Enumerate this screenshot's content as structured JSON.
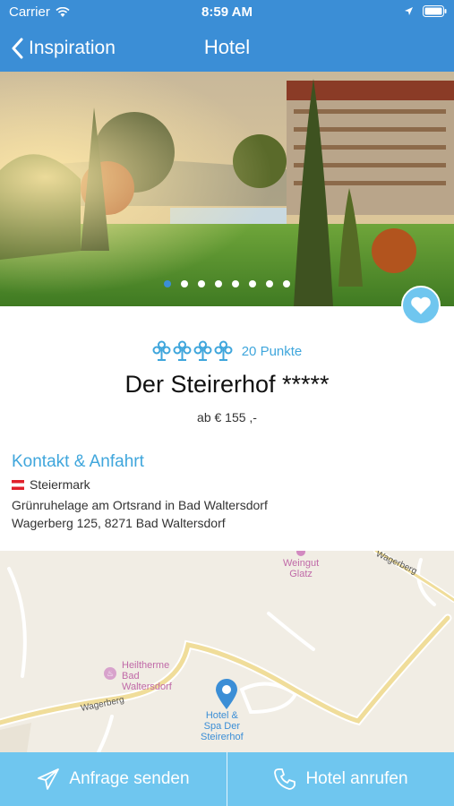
{
  "status_bar": {
    "carrier": "Carrier",
    "time": "8:59 AM"
  },
  "nav": {
    "back_label": "Inspiration",
    "title": "Hotel"
  },
  "gallery": {
    "photo_count": 8,
    "active_index": 0
  },
  "hotel": {
    "points": "20 Punkte",
    "name": "Der Steirerhof *****",
    "price": "ab € 155 ,-"
  },
  "contact": {
    "heading": "Kontakt & Anfahrt",
    "region": "Steiermark",
    "location_note": "Grünruhelage am Ortsrand in Bad Waltersdorf",
    "address": "Wagerberg 125, 8271 Bad Waltersdorf"
  },
  "map": {
    "poi_weingut_line1": "Weingut",
    "poi_weingut_line2": "Glatz",
    "poi_therme_line1": "Heiltherme",
    "poi_therme_line2": "Bad",
    "poi_therme_line3": "Waltersdorf",
    "hotel_line1": "Hotel &",
    "hotel_line2": "Spa Der",
    "hotel_line3": "Steirerhof",
    "road_wagerberg_1": "Wagerberg",
    "road_wagerberg_2": "Wagerberg"
  },
  "actions": {
    "inquiry": "Anfrage senden",
    "call": "Hotel anrufen"
  },
  "colors": {
    "brand_blue": "#3b8ed6",
    "accent_light": "#6fc6ef",
    "text_accent": "#3fa6dc"
  }
}
